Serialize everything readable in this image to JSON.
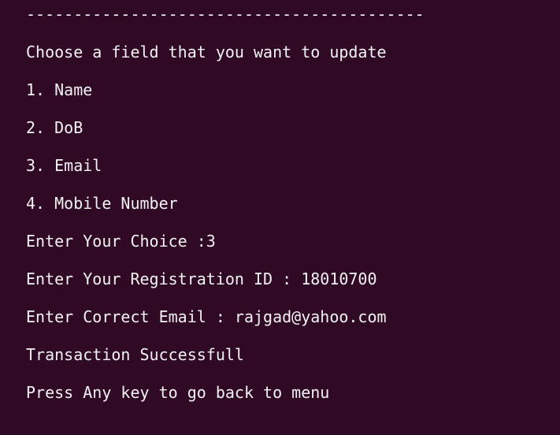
{
  "terminal": {
    "separator": "------------------------------------------",
    "prompt": "Choose a field that you want to update",
    "options": [
      "1. Name",
      "2. DoB",
      "3. Email",
      "4. Mobile Number"
    ],
    "choice_line": "Enter Your Choice :3",
    "registration_line": "Enter Your Registration ID : 18010700",
    "email_line": "Enter Correct Email : rajgad@yahoo.com",
    "status_line": "Transaction Successfull",
    "footer_line": "Press Any key to go back to menu"
  }
}
